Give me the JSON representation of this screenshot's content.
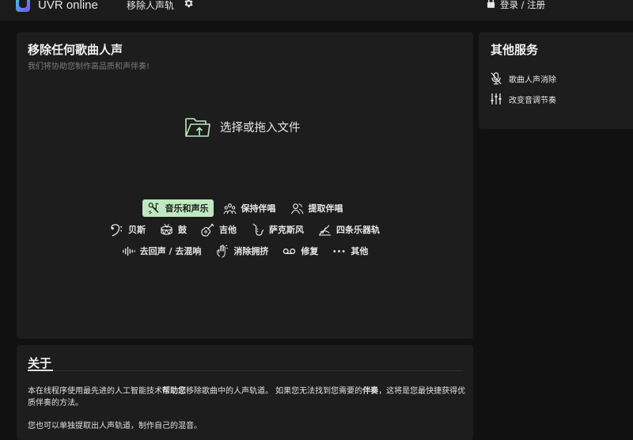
{
  "topbar": {
    "brand": "UVR online",
    "nav_label": "移除人声轨",
    "login_label": "登录 / 注册"
  },
  "upload": {
    "title": "移除任何歌曲人声",
    "subtitle": "我们将协助您制作高品质和声伴奏!",
    "drop_label": "选择或拖入文件",
    "options_row1": [
      {
        "label": "音乐和声乐",
        "icon": "music-mic-icon",
        "active": true
      },
      {
        "label": "保持伴唱",
        "icon": "choir-icon",
        "active": false
      },
      {
        "label": "提取伴唱",
        "icon": "people-icon",
        "active": false
      }
    ],
    "options_row2": [
      {
        "label": "贝斯",
        "icon": "bass-clef-icon"
      },
      {
        "label": "鼓",
        "icon": "drum-icon"
      },
      {
        "label": "吉他",
        "icon": "guitar-icon"
      },
      {
        "label": "萨克斯风",
        "icon": "saxophone-icon"
      },
      {
        "label": "四条乐器轨",
        "icon": "instrument-tracks-icon"
      }
    ],
    "options_row3": [
      {
        "label": "去回声 / 去混响",
        "icon": "echo-icon"
      },
      {
        "label": "消除拥挤",
        "icon": "crowd-icon"
      },
      {
        "label": "修复",
        "icon": "tape-icon"
      },
      {
        "label": "其他",
        "icon": "more-icon"
      }
    ]
  },
  "side": {
    "title": "其他服务",
    "items": [
      {
        "label": "歌曲人声消除",
        "icon": "mic-off-icon"
      },
      {
        "label": "改变音调节奏",
        "icon": "sliders-icon"
      }
    ]
  },
  "about": {
    "title": "关于",
    "p1_a": "本在线程序使用最先进的人工智能技术",
    "p1_b": "帮助您",
    "p1_c": "移除歌曲中的人声轨道。 如果您无法找到您需要的",
    "p1_d": "伴奏",
    "p1_e": "，这将是您最快捷获得优质伴奏的方法。",
    "p2": "您也可以单独提取出人声轨道，制作自己的混音。"
  },
  "colors": {
    "accent": "#bfe8c0",
    "card": "#1d1d1d",
    "background": "#111111"
  }
}
